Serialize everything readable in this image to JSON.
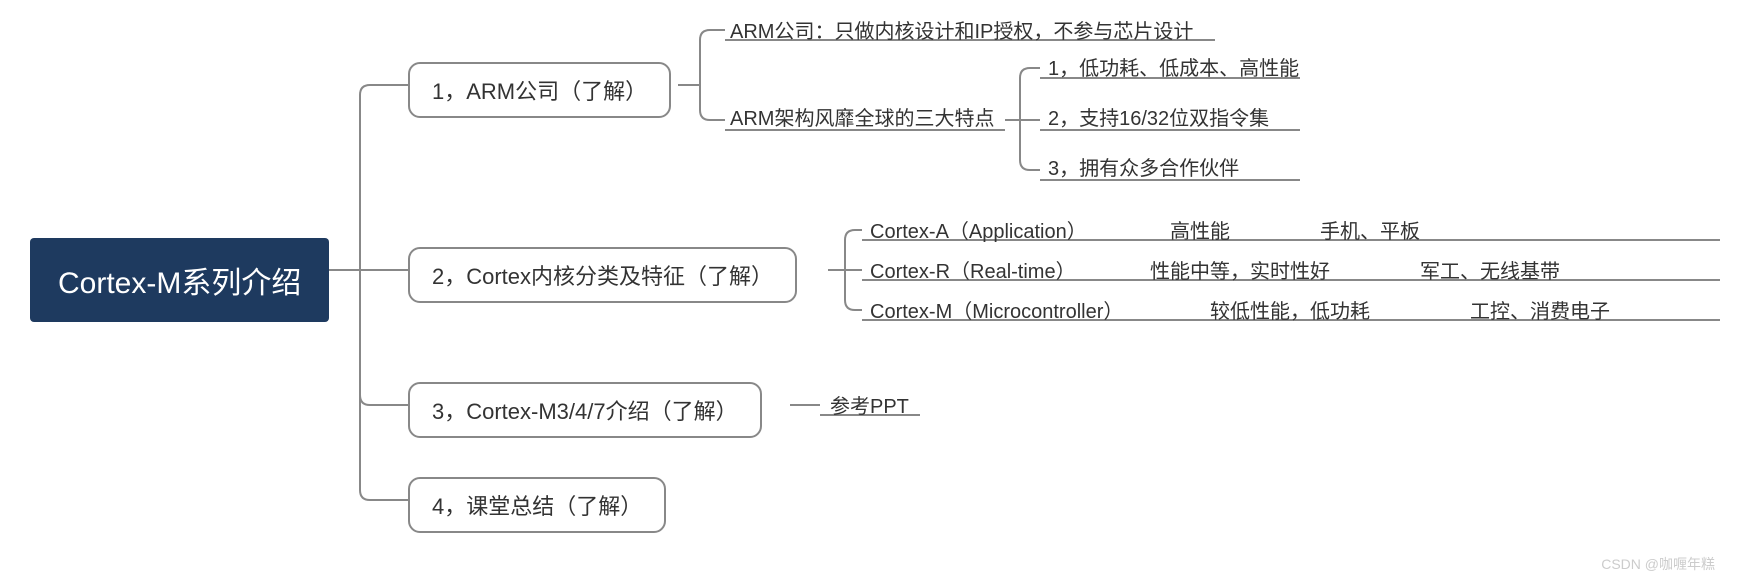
{
  "root": {
    "title": "Cortex-M系列介绍"
  },
  "branches": {
    "b1": {
      "label": "1，ARM公司（了解）"
    },
    "b2": {
      "label": "2，Cortex内核分类及特征（了解）"
    },
    "b3": {
      "label": "3，Cortex-M3/4/7介绍（了解）"
    },
    "b4": {
      "label": "4，课堂总结（了解）"
    }
  },
  "b1_children": {
    "c1": "ARM公司：只做内核设计和IP授权，不参与芯片设计",
    "c2": "ARM架构风靡全球的三大特点",
    "c2_sub": {
      "s1": "1，低功耗、低成本、高性能",
      "s2": "2，支持16/32位双指令集",
      "s3": "3，拥有众多合作伙伴"
    }
  },
  "b2_children": {
    "r1": {
      "name": "Cortex-A（Application）",
      "perf": "高性能",
      "use": "手机、平板"
    },
    "r2": {
      "name": "Cortex-R（Real-time）",
      "perf": "性能中等，实时性好",
      "use": "军工、无线基带"
    },
    "r3": {
      "name": "Cortex-M（Microcontroller）",
      "perf": "较低性能，低功耗",
      "use": "工控、消费电子"
    }
  },
  "b3_children": {
    "c1": "参考PPT"
  },
  "watermark": "CSDN @咖喱年糕"
}
